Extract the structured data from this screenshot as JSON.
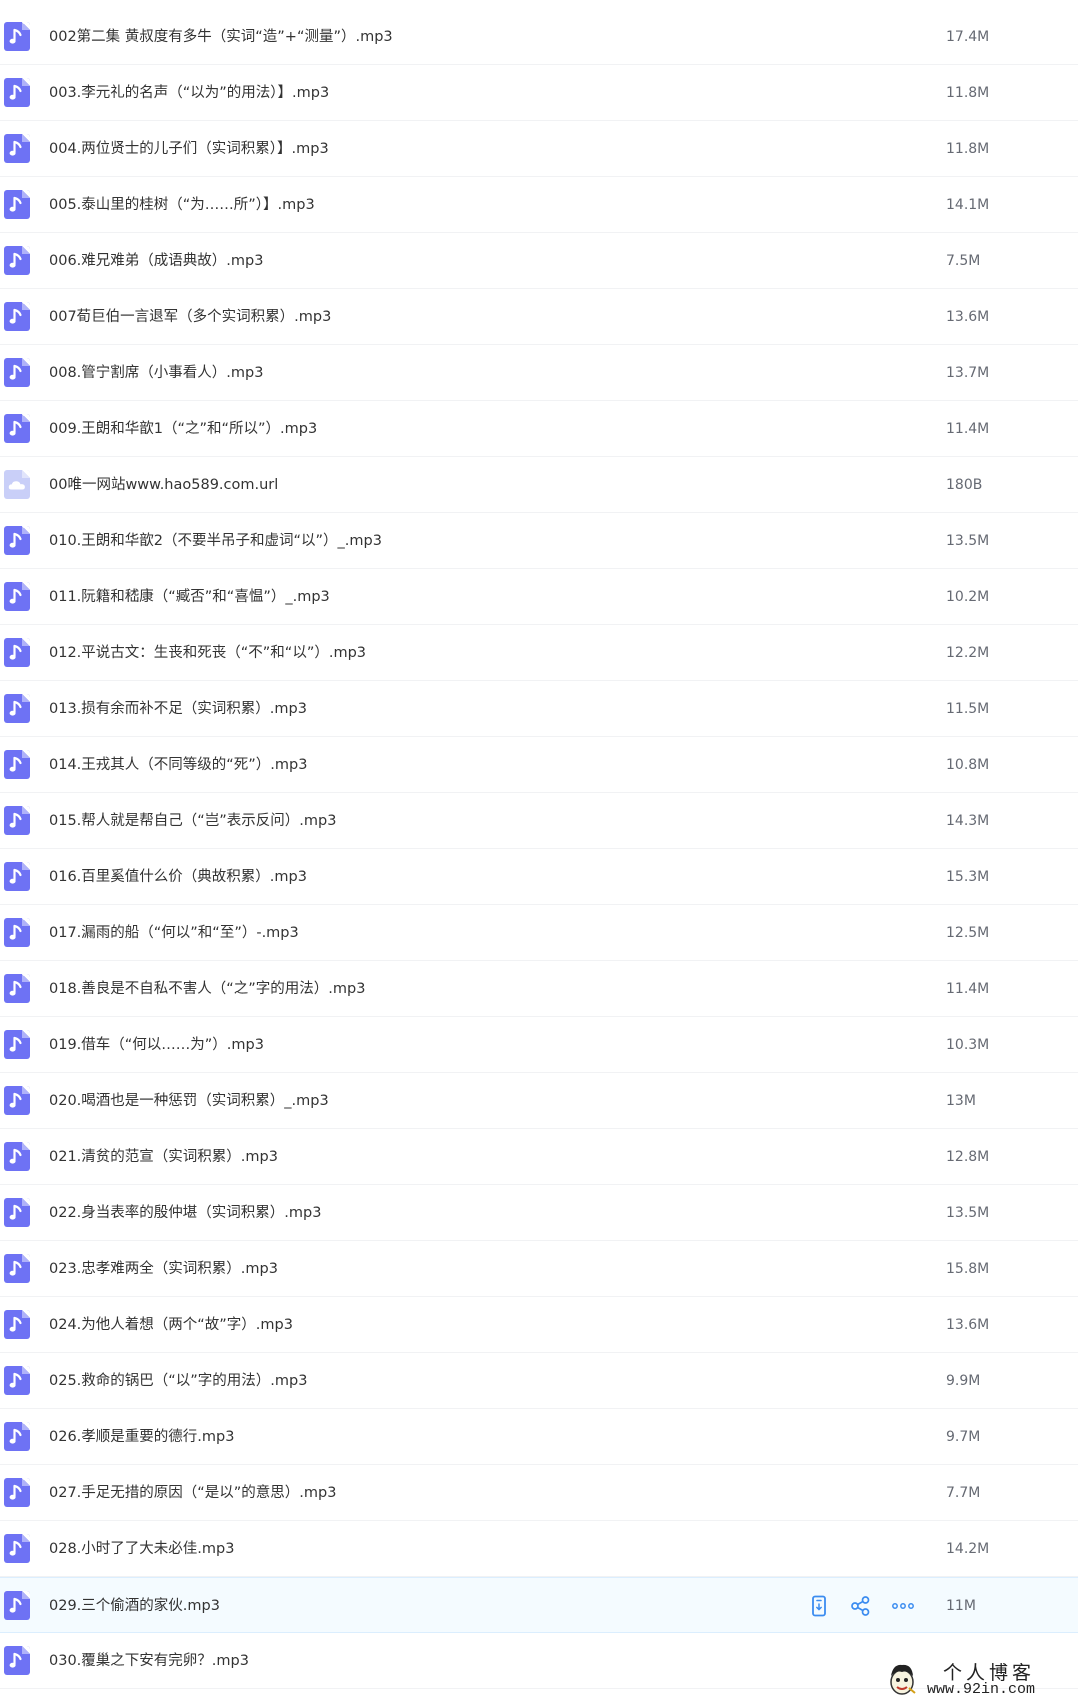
{
  "colors": {
    "audio_icon": "#6e72f4",
    "link_icon": "#c9cff8",
    "action_icon": "#3b8cf0",
    "size_text": "#666a73",
    "active_row": "#f4fbff"
  },
  "files": [
    {
      "name": "002第二集 黄叔度有多牛（实词“造”+“测量”）.mp3",
      "size": "17.4M",
      "icon": "audio-file-icon"
    },
    {
      "name": "003.李元礼的名声（“以为”的用法）】.mp3",
      "size": "11.8M",
      "icon": "audio-file-icon"
    },
    {
      "name": "004.两位贤士的儿子们（实词积累）】.mp3",
      "size": "11.8M",
      "icon": "audio-file-icon"
    },
    {
      "name": "005.泰山里的桂树（“为……所”）】.mp3",
      "size": "14.1M",
      "icon": "audio-file-icon"
    },
    {
      "name": "006.难兄难弟（成语典故）.mp3",
      "size": "7.5M",
      "icon": "audio-file-icon"
    },
    {
      "name": "007荀巨伯一言退军（多个实词积累）.mp3",
      "size": "13.6M",
      "icon": "audio-file-icon"
    },
    {
      "name": "008.管宁割席（小事看人）.mp3",
      "size": "13.7M",
      "icon": "audio-file-icon"
    },
    {
      "name": "009.王朗和华歆1（“之”和“所以”）.mp3",
      "size": "11.4M",
      "icon": "audio-file-icon"
    },
    {
      "name": "00唯一网站www.hao589.com.url",
      "size": "180B",
      "icon": "link-file-icon"
    },
    {
      "name": "010.王朗和华歆2（不要半吊子和虚词“以”）_.mp3",
      "size": "13.5M",
      "icon": "audio-file-icon"
    },
    {
      "name": "011.阮籍和嵇康（“臧否”和“喜愠”）_.mp3",
      "size": "10.2M",
      "icon": "audio-file-icon"
    },
    {
      "name": "012.平说古文：生丧和死丧（“不”和“以”）.mp3",
      "size": "12.2M",
      "icon": "audio-file-icon"
    },
    {
      "name": "013.损有余而补不足（实词积累）.mp3",
      "size": "11.5M",
      "icon": "audio-file-icon"
    },
    {
      "name": "014.王戎其人（不同等级的“死”）.mp3",
      "size": "10.8M",
      "icon": "audio-file-icon"
    },
    {
      "name": "015.帮人就是帮自己（“岂”表示反问）.mp3",
      "size": "14.3M",
      "icon": "audio-file-icon"
    },
    {
      "name": "016.百里奚值什么价（典故积累）.mp3",
      "size": "15.3M",
      "icon": "audio-file-icon"
    },
    {
      "name": "017.漏雨的船（“何以”和“至”）-.mp3",
      "size": "12.5M",
      "icon": "audio-file-icon"
    },
    {
      "name": "018.善良是不自私不害人（“之”字的用法）.mp3",
      "size": "11.4M",
      "icon": "audio-file-icon"
    },
    {
      "name": "019.借车（“何以……为”）.mp3",
      "size": "10.3M",
      "icon": "audio-file-icon"
    },
    {
      "name": "020.喝酒也是一种惩罚（实词积累）_.mp3",
      "size": "13M",
      "icon": "audio-file-icon"
    },
    {
      "name": "021.清贫的范宣（实词积累）.mp3",
      "size": "12.8M",
      "icon": "audio-file-icon"
    },
    {
      "name": "022.身当表率的殷仲堪（实词积累）.mp3",
      "size": "13.5M",
      "icon": "audio-file-icon"
    },
    {
      "name": "023.忠孝难两全（实词积累）.mp3",
      "size": "15.8M",
      "icon": "audio-file-icon"
    },
    {
      "name": "024.为他人着想（两个“故”字）.mp3",
      "size": "13.6M",
      "icon": "audio-file-icon"
    },
    {
      "name": "025.救命的锅巴（“以”字的用法）.mp3",
      "size": "9.9M",
      "icon": "audio-file-icon"
    },
    {
      "name": "026.孝顺是重要的德行.mp3",
      "size": "9.7M",
      "icon": "audio-file-icon"
    },
    {
      "name": "027.手足无措的原因（“是以”的意思）.mp3",
      "size": "7.7M",
      "icon": "audio-file-icon"
    },
    {
      "name": "028.小时了了大未必佳.mp3",
      "size": "14.2M",
      "icon": "audio-file-icon"
    },
    {
      "name": "029.三个偷酒的家伙.mp3",
      "size": "11M",
      "icon": "audio-file-icon",
      "active": true
    },
    {
      "name": "030.覆巢之下安有完卵？.mp3",
      "size": "",
      "icon": "audio-file-icon"
    }
  ],
  "row_actions": [
    {
      "name": "send-to-phone-icon"
    },
    {
      "name": "share-icon"
    },
    {
      "name": "more-options-icon"
    }
  ],
  "watermark": {
    "title": "个人博客",
    "url": "www.92in.com"
  }
}
